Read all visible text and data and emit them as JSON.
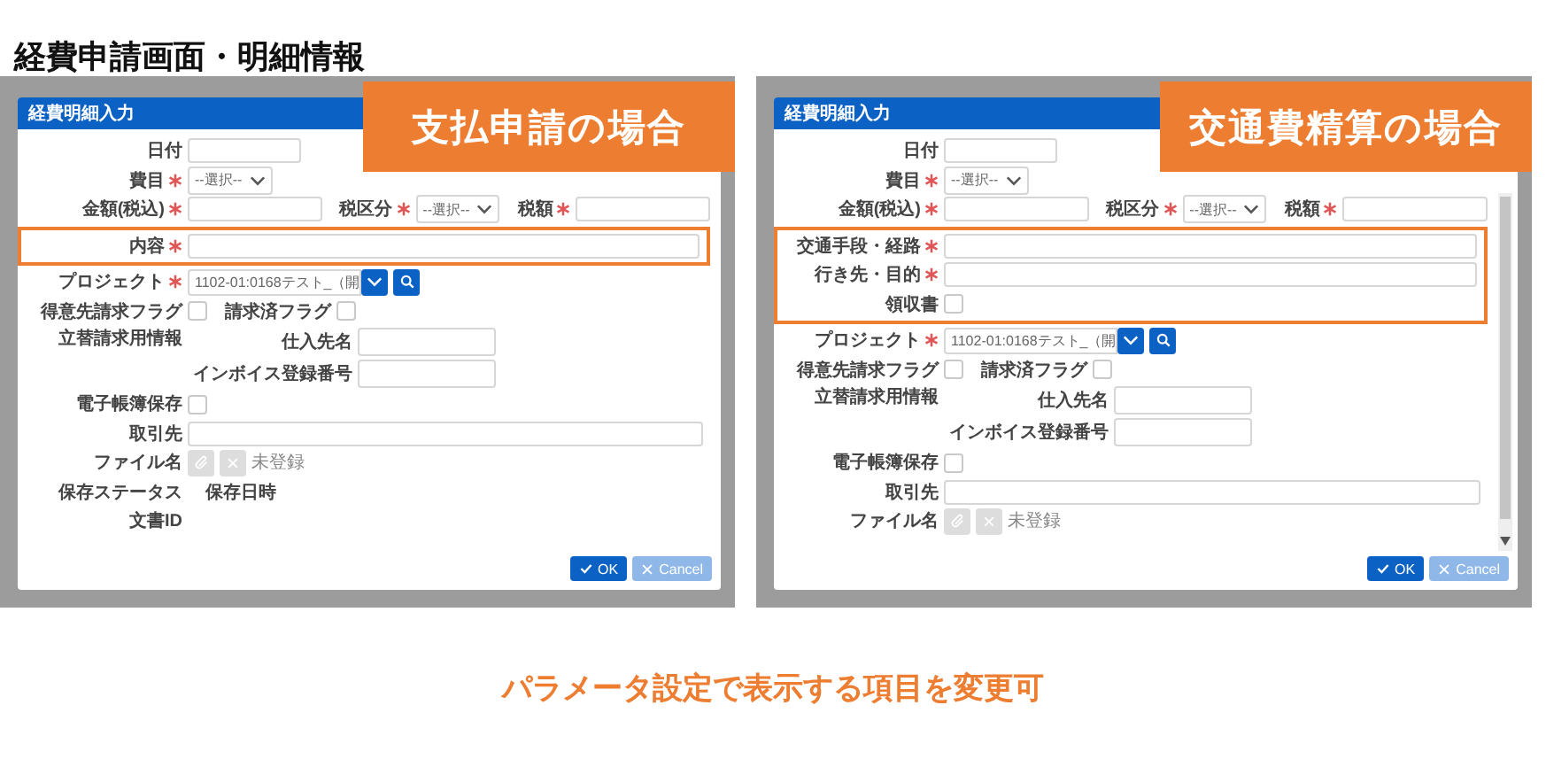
{
  "title": "経費申請画面・明細情報",
  "panels": [
    {
      "tag": "支払申請の場合",
      "dialog": {
        "title": "経費明細入力",
        "scrollable": false,
        "rows": [
          {
            "highlighted": false,
            "items": [
              {
                "kind": "short_text",
                "label": "日付",
                "required": false
              }
            ]
          },
          {
            "highlighted": false,
            "items": [
              {
                "kind": "select",
                "label": "費目",
                "required": true,
                "value": "--選択--"
              }
            ]
          },
          {
            "highlighted": false,
            "items": [
              {
                "kind": "medium_text",
                "label": "金額(税込)",
                "required": true
              },
              {
                "kind": "select",
                "label": "税区分",
                "required": true,
                "value": "--選択--"
              },
              {
                "kind": "medium_text",
                "label": "税額",
                "required": true
              }
            ]
          },
          {
            "highlighted": true,
            "items": [
              {
                "kind": "wide_text",
                "label": "内容",
                "required": true
              }
            ]
          },
          {
            "highlighted": false,
            "items": [
              {
                "kind": "project",
                "label": "プロジェクト",
                "required": true,
                "value": "1102-01:0168テスト_（開"
              }
            ]
          },
          {
            "highlighted": false,
            "items": [
              {
                "kind": "checkbox",
                "label": "得意先請求フラグ",
                "required": false,
                "checked": false
              },
              {
                "kind": "checkbox",
                "label": "請求済フラグ",
                "required": false,
                "checked": false
              }
            ]
          },
          {
            "highlighted": false,
            "items": [
              {
                "kind": "group",
                "label": "立替請求用情報",
                "fields": [
                  {
                    "label": "仕入先名"
                  },
                  {
                    "label": "インボイス登録番号"
                  }
                ]
              }
            ]
          },
          {
            "highlighted": false,
            "items": [
              {
                "kind": "checkbox",
                "label": "電子帳簿保存",
                "required": false,
                "checked": false
              }
            ]
          },
          {
            "highlighted": false,
            "items": [
              {
                "kind": "wide_text",
                "label": "取引先",
                "required": false
              }
            ]
          },
          {
            "highlighted": false,
            "items": [
              {
                "kind": "file",
                "label": "ファイル名",
                "required": false,
                "status": "未登録"
              }
            ]
          },
          {
            "highlighted": false,
            "items": [
              {
                "kind": "info",
                "label": "保存ステータス"
              },
              {
                "kind": "info",
                "label": "保存日時"
              }
            ]
          },
          {
            "highlighted": false,
            "items": [
              {
                "kind": "info",
                "label": "文書ID"
              }
            ]
          }
        ],
        "buttons": [
          {
            "kind": "confirm",
            "label": "OK",
            "disabled": false
          },
          {
            "kind": "cancel",
            "label": "Cancel",
            "disabled": true
          }
        ]
      }
    },
    {
      "tag": "交通費精算の場合",
      "dialog": {
        "title": "経費明細入力",
        "scrollable": true,
        "rows": [
          {
            "highlighted": false,
            "items": [
              {
                "kind": "short_text",
                "label": "日付",
                "required": false
              }
            ]
          },
          {
            "highlighted": false,
            "items": [
              {
                "kind": "select",
                "label": "費目",
                "required": true,
                "value": "--選択--"
              }
            ]
          },
          {
            "highlighted": false,
            "items": [
              {
                "kind": "medium_text",
                "label": "金額(税込)",
                "required": true
              },
              {
                "kind": "select",
                "label": "税区分",
                "required": true,
                "value": "--選択--"
              },
              {
                "kind": "medium_text",
                "label": "税額",
                "required": true
              }
            ]
          },
          {
            "highlighted": true,
            "items": [
              {
                "kind": "wide_text",
                "label": "交通手段・経路",
                "required": true
              }
            ]
          },
          {
            "highlighted": true,
            "items": [
              {
                "kind": "wide_text",
                "label": "行き先・目的",
                "required": true
              }
            ]
          },
          {
            "highlighted": true,
            "items": [
              {
                "kind": "checkbox",
                "label": "領収書",
                "required": false,
                "checked": false
              }
            ]
          },
          {
            "highlighted": false,
            "items": [
              {
                "kind": "project",
                "label": "プロジェクト",
                "required": true,
                "value": "1102-01:0168テスト_（開"
              }
            ]
          },
          {
            "highlighted": false,
            "items": [
              {
                "kind": "checkbox",
                "label": "得意先請求フラグ",
                "required": false,
                "checked": false
              },
              {
                "kind": "checkbox",
                "label": "請求済フラグ",
                "required": false,
                "checked": false
              }
            ]
          },
          {
            "highlighted": false,
            "items": [
              {
                "kind": "group",
                "label": "立替請求用情報",
                "fields": [
                  {
                    "label": "仕入先名"
                  },
                  {
                    "label": "インボイス登録番号"
                  }
                ]
              }
            ]
          },
          {
            "highlighted": false,
            "items": [
              {
                "kind": "checkbox",
                "label": "電子帳簿保存",
                "required": false,
                "checked": false
              }
            ]
          },
          {
            "highlighted": false,
            "items": [
              {
                "kind": "wide_text",
                "label": "取引先",
                "required": false
              }
            ]
          },
          {
            "highlighted": false,
            "items": [
              {
                "kind": "file",
                "label": "ファイル名",
                "required": false,
                "status": "未登録"
              }
            ]
          }
        ],
        "buttons": [
          {
            "kind": "confirm",
            "label": "OK",
            "disabled": false
          },
          {
            "kind": "cancel",
            "label": "Cancel",
            "disabled": true
          }
        ]
      }
    }
  ],
  "caption": "パラメータ設定で表示する項目を変更可"
}
